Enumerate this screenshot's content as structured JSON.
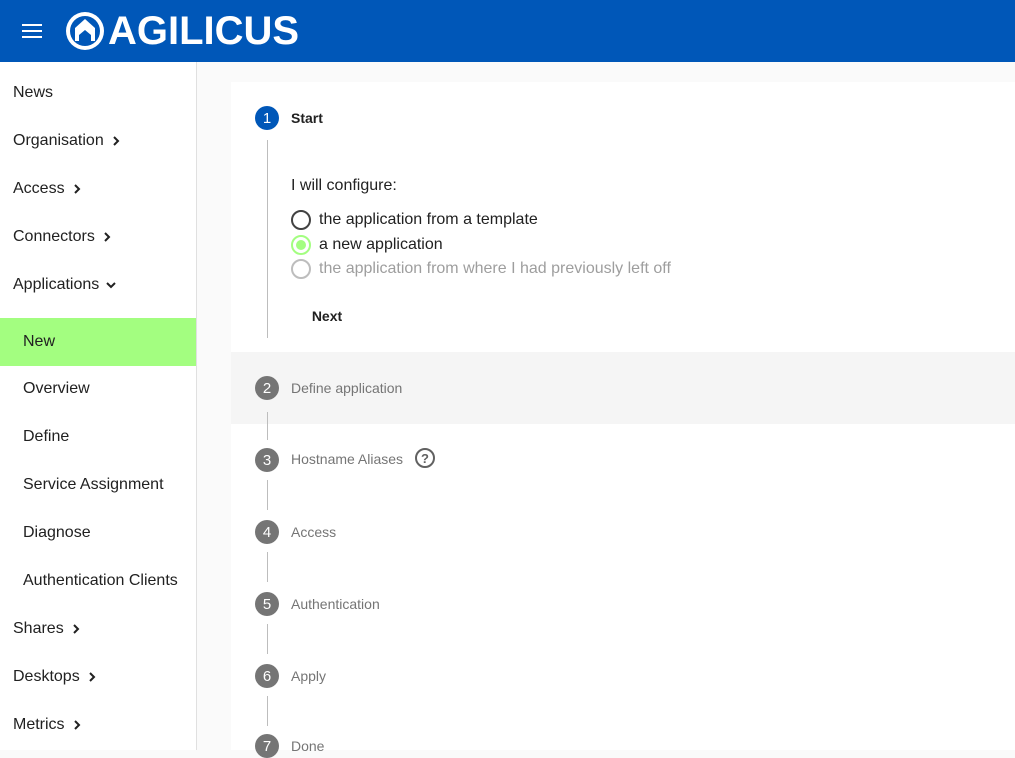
{
  "header": {
    "logo_text": "AGILICUS",
    "accent_color": "#0057b8"
  },
  "sidebar": {
    "items": [
      {
        "label": "News"
      },
      {
        "label": "Organisation"
      },
      {
        "label": "Access"
      },
      {
        "label": "Connectors"
      },
      {
        "label": "Applications"
      },
      {
        "label": "New",
        "active": true
      },
      {
        "label": "Overview"
      },
      {
        "label": "Define"
      },
      {
        "label": "Service Assignment"
      },
      {
        "label": "Diagnose"
      },
      {
        "label": "Authentication Clients"
      },
      {
        "label": "Shares"
      },
      {
        "label": "Desktops"
      },
      {
        "label": "Metrics"
      }
    ],
    "active_color": "#a3fe80"
  },
  "stepper": {
    "steps": [
      {
        "num": "1",
        "label": "Start"
      },
      {
        "num": "2",
        "label": "Define application"
      },
      {
        "num": "3",
        "label": "Hostname Aliases"
      },
      {
        "num": "4",
        "label": "Access"
      },
      {
        "num": "5",
        "label": "Authentication"
      },
      {
        "num": "6",
        "label": "Apply"
      },
      {
        "num": "7",
        "label": "Done"
      }
    ],
    "start": {
      "prompt": "I will configure:",
      "options": [
        {
          "label": "the application from a template"
        },
        {
          "label": "a new application",
          "selected": true
        },
        {
          "label": "the application from where I had previously left off",
          "disabled": true
        }
      ],
      "next_label": "Next"
    },
    "help_icon_glyph": "?"
  }
}
